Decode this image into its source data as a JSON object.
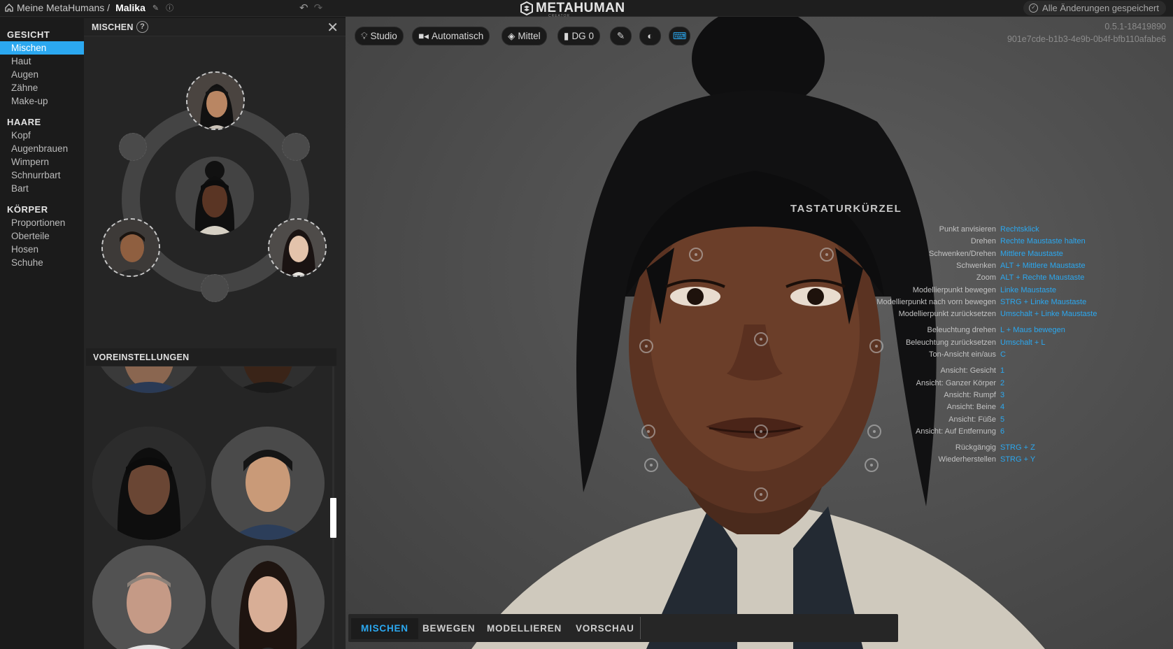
{
  "topbar": {
    "breadcrumb_root": "Meine MetaHumans /",
    "breadcrumb_current": "Malika",
    "logo_text": "METAHUMAN",
    "logo_sub": "CREATOR",
    "saved_status": "Alle Änderungen gespeichert"
  },
  "sidebar": {
    "sections": [
      {
        "title": "GESICHT",
        "items": [
          "Mischen",
          "Haut",
          "Augen",
          "Zähne",
          "Make-up"
        ]
      },
      {
        "title": "HAARE",
        "items": [
          "Kopf",
          "Augenbrauen",
          "Wimpern",
          "Schnurrbart",
          "Bart"
        ]
      },
      {
        "title": "KÖRPER",
        "items": [
          "Proportionen",
          "Oberteile",
          "Hosen",
          "Schuhe"
        ]
      }
    ],
    "active_item": "Mischen"
  },
  "panel": {
    "title": "MISCHEN",
    "help": "?",
    "close": "✕",
    "presets_title": "VOREINSTELLUNGEN"
  },
  "viewport": {
    "toolbar": [
      "Studio",
      "Automatisch",
      "Mittel",
      "DG 0"
    ],
    "version": "0.5.1-18419890",
    "guid": "901e7cde-b1b3-4e9b-0b4f-bfb110afabe6",
    "shortcuts_title": "TASTATURKÜRZEL",
    "shortcuts": [
      {
        "k": "Punkt anvisieren",
        "v": "Rechtsklick"
      },
      {
        "k": "Drehen",
        "v": "Rechte Maustaste halten"
      },
      {
        "k": "Schwenken/Drehen",
        "v": "Mittlere Maustaste"
      },
      {
        "k": "Schwenken",
        "v": "ALT + Mittlere Maustaste"
      },
      {
        "k": "Zoom",
        "v": "ALT + Rechte Maustaste"
      },
      {
        "k": "Modellierpunkt bewegen",
        "v": "Linke Maustaste"
      },
      {
        "k": "Modellierpunkt nach vorn bewegen",
        "v": "STRG + Linke Maustaste"
      },
      {
        "k": "Modellierpunkt zurücksetzen",
        "v": "Umschalt + Linke Maustaste"
      },
      {
        "k": "Beleuchtung drehen",
        "v": "L + Maus bewegen"
      },
      {
        "k": "Beleuchtung zurücksetzen",
        "v": "Umschalt + L"
      },
      {
        "k": "Ton-Ansicht ein/aus",
        "v": "C"
      },
      {
        "k": "Ansicht: Gesicht",
        "v": "1"
      },
      {
        "k": "Ansicht: Ganzer Körper",
        "v": "2"
      },
      {
        "k": "Ansicht: Rumpf",
        "v": "3"
      },
      {
        "k": "Ansicht: Beine",
        "v": "4"
      },
      {
        "k": "Ansicht: Füße",
        "v": "5"
      },
      {
        "k": "Ansicht: Auf Entfernung",
        "v": "6"
      },
      {
        "k": "Rückgängig",
        "v": "STRG + Z"
      },
      {
        "k": "Wiederherstellen",
        "v": "STRG + Y"
      }
    ]
  },
  "tabs": [
    "MISCHEN",
    "BEWEGEN",
    "MODELLIEREN",
    "VORSCHAU"
  ],
  "colors": {
    "accent": "#2ba8f0"
  }
}
